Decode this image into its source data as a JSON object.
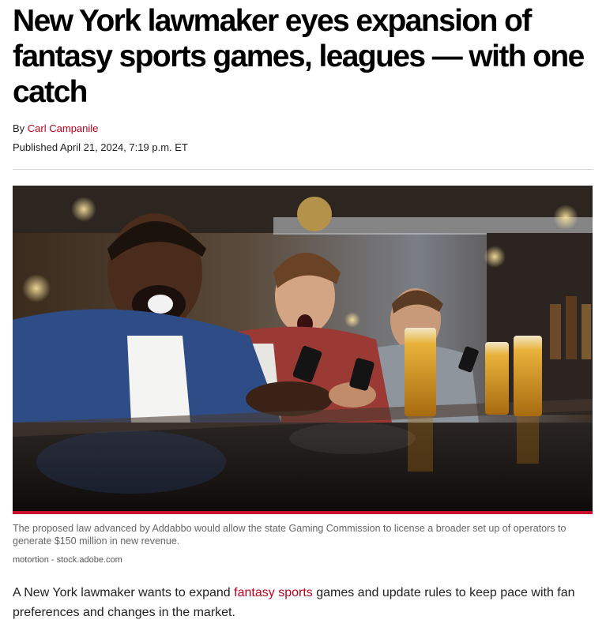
{
  "article": {
    "headline": "New York lawmaker eyes expansion of fantasy sports games, leagues — with one catch",
    "byline_prefix": "By",
    "author": "Carl Campanile",
    "published": "Published April 21, 2024, 7:19 p.m. ET",
    "image": {
      "caption": "The proposed law advanced by Addabbo would allow the state Gaming Commission to license a broader set up of operators to generate $150 million in new revenue.",
      "credit": "motortion - stock.adobe.com"
    },
    "body": {
      "text_before_link": "A New York lawmaker wants to expand ",
      "link_text": "fantasy sports",
      "text_after_link": " games and update rules to keep pace with fan preferences and changes in the market."
    }
  },
  "colors": {
    "link": "#b8001c",
    "accent_bar": "#c8102e",
    "divider": "#d4d4d4"
  }
}
